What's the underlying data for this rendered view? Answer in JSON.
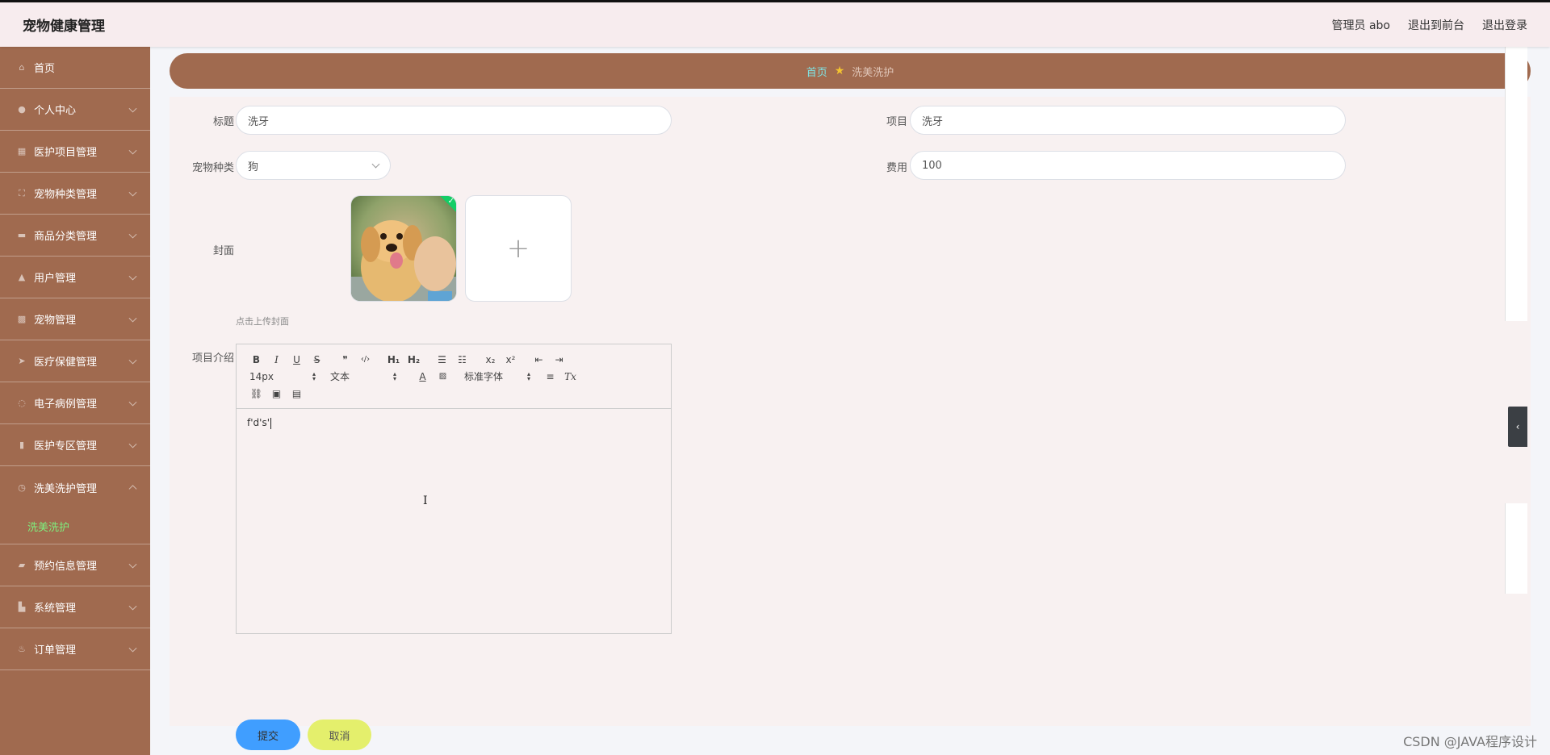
{
  "header": {
    "title": "宠物健康管理",
    "user": "管理员 abo",
    "to_front": "退出到前台",
    "logout": "退出登录"
  },
  "sidebar": {
    "items": [
      {
        "label": "首页",
        "icon": "home-icon"
      },
      {
        "label": "个人中心",
        "icon": "user-icon"
      },
      {
        "label": "医护项目管理",
        "icon": "grid-icon"
      },
      {
        "label": "宠物种类管理",
        "icon": "frame-icon"
      },
      {
        "label": "商品分类管理",
        "icon": "box-icon"
      },
      {
        "label": "用户管理",
        "icon": "users-icon"
      },
      {
        "label": "宠物管理",
        "icon": "tiles-icon"
      },
      {
        "label": "医疗保健管理",
        "icon": "send-icon"
      },
      {
        "label": "电子病例管理",
        "icon": "power-icon"
      },
      {
        "label": "医护专区管理",
        "icon": "clipboard-icon"
      },
      {
        "label": "洗美洗护管理",
        "icon": "clock-icon"
      },
      {
        "label": "预约信息管理",
        "icon": "ticket-icon"
      },
      {
        "label": "系统管理",
        "icon": "tool-icon"
      },
      {
        "label": "订单管理",
        "icon": "mic-icon"
      }
    ],
    "submenu_active": "洗美洗护"
  },
  "breadcrumb": {
    "home": "首页",
    "current": "洗美洗护"
  },
  "form": {
    "title_label": "标题",
    "title_value": "洗牙",
    "project_label": "项目",
    "project_value": "洗牙",
    "species_label": "宠物种类",
    "species_value": "狗",
    "fee_label": "费用",
    "fee_value": "100",
    "cover_label": "封面",
    "cover_hint": "点击上传封面",
    "intro_label": "项目介绍",
    "editor_content": "f'd's'",
    "submit_label": "提交",
    "cancel_label": "取消"
  },
  "editor_toolbar": {
    "bold": "B",
    "italic": "I",
    "underline": "U",
    "strike": "S",
    "quote": "❞",
    "code": "‹/›",
    "h1": "H₁",
    "h2": "H₂",
    "sub": "x₂",
    "sup": "x²",
    "size_value": "14px",
    "text_value": "文本",
    "font_value": "标准字体",
    "clear": "Tx"
  },
  "watermark": "CSDN @JAVA程序设计",
  "colors": {
    "sidebar_bg": "#a06a4f",
    "header_bg": "#f7ecee",
    "submit_bg": "#409eff",
    "cancel_bg": "#e4ef6c",
    "submenu_active": "#7ef07e"
  }
}
